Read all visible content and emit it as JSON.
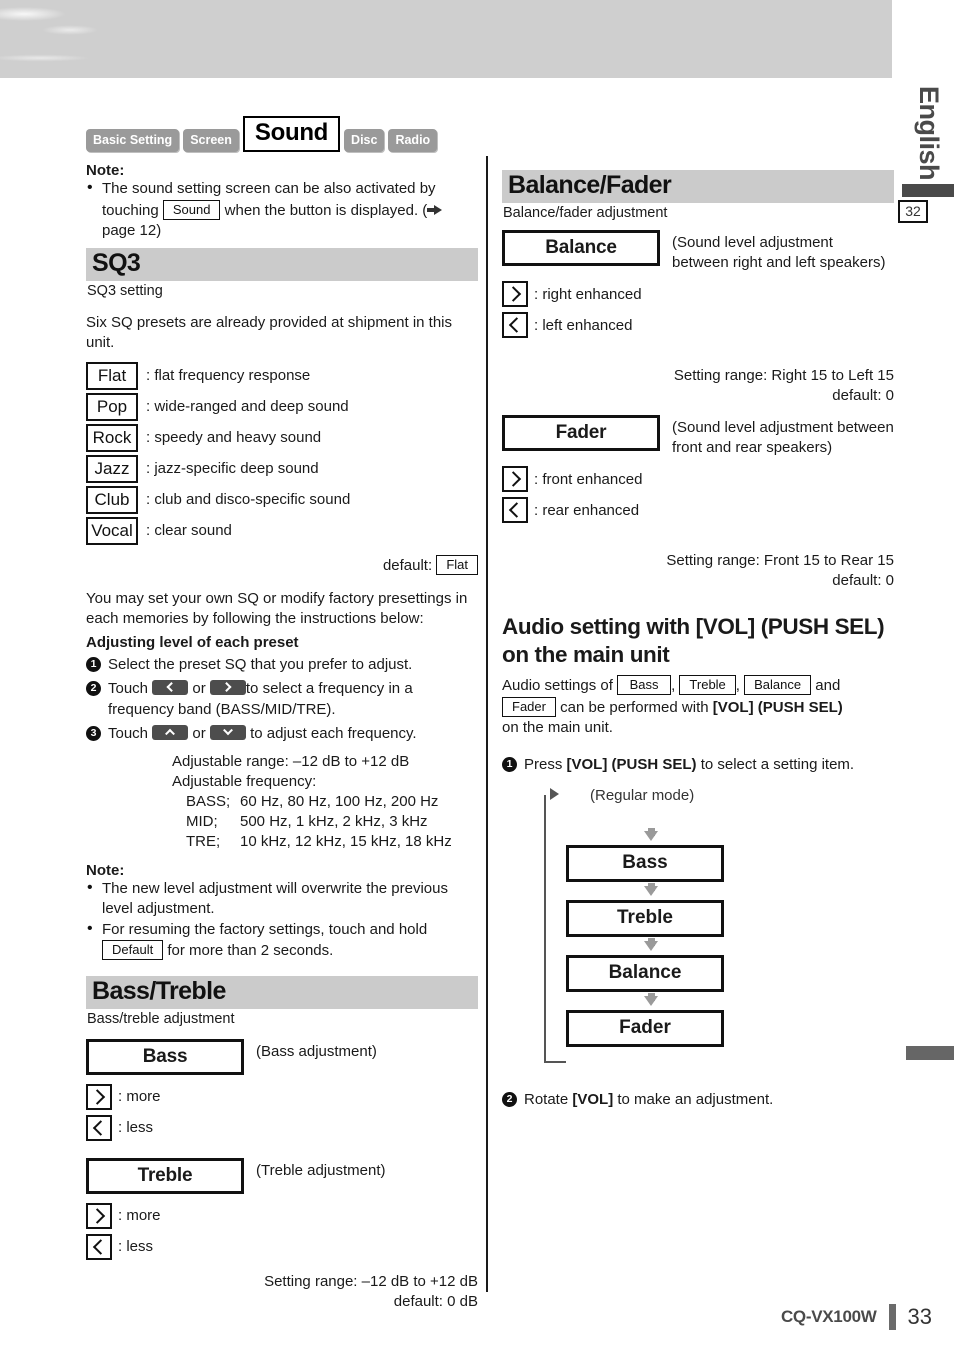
{
  "header": {
    "language_label": "English",
    "edge_page_marker": "32",
    "tabs": [
      {
        "label": "Basic Setting",
        "active": false
      },
      {
        "label": "Screen",
        "active": false
      },
      {
        "label": "Sound",
        "active": true
      },
      {
        "label": "Disc",
        "active": false
      },
      {
        "label": "Radio",
        "active": false
      }
    ]
  },
  "left": {
    "note_top": {
      "title": "Note:",
      "item_part1": "The sound setting screen can be also activated by touching",
      "inline_button": "Sound",
      "item_part2": "when the button is displayed. (",
      "item_part3": "page 12)"
    },
    "sq3": {
      "heading": "SQ3",
      "caption": "SQ3 setting",
      "intro": "Six SQ presets are already provided at shipment in this unit.",
      "presets": [
        {
          "name": "Flat",
          "desc": ": flat frequency response"
        },
        {
          "name": "Pop",
          "desc": ": wide-ranged and deep sound"
        },
        {
          "name": "Rock",
          "desc": ": speedy and heavy sound"
        },
        {
          "name": "Jazz",
          "desc": ": jazz-specific deep sound"
        },
        {
          "name": "Club",
          "desc": ": club and disco-specific sound"
        },
        {
          "name": "Vocal",
          "desc": ": clear sound"
        }
      ],
      "default_label": "default:",
      "default_value": "Flat",
      "body": "You may set your own SQ or modify factory presettings in each memories by following the instructions below:",
      "adjust_title": "Adjusting level of each preset",
      "step1_num": "1",
      "step1_text": "Select the preset SQ that you prefer to adjust.",
      "step2_num": "2",
      "step2_a": "Touch",
      "step2_b": "or",
      "step2_c": "to select a frequency in a frequency band (BASS/MID/TRE).",
      "step3_num": "3",
      "step3_a": "Touch",
      "step3_b": "or",
      "step3_c": "to adjust each frequency.",
      "spec_range": "Adjustable range: –12 dB to +12 dB",
      "spec_freq_title": "Adjustable frequency:",
      "spec_rows": [
        {
          "band": "BASS;",
          "values": "60 Hz, 80 Hz, 100 Hz, 200 Hz"
        },
        {
          "band": "MID;",
          "values": "500 Hz, 1 kHz, 2 kHz, 3 kHz"
        },
        {
          "band": "TRE;",
          "values": "10 kHz, 12 kHz, 15 kHz, 18 kHz"
        }
      ]
    },
    "note_bottom": {
      "title": "Note:",
      "item1": "The new level adjustment will overwrite the previous level adjustment.",
      "item2_a": "For resuming the factory settings, touch and hold",
      "item2_button": "Default",
      "item2_b": "for more than 2 seconds."
    },
    "bass_treble": {
      "heading": "Bass/Treble",
      "caption": "Bass/treble adjustment",
      "bass_button": "Bass",
      "bass_note": "(Bass adjustment)",
      "bass_more": ": more",
      "bass_less": ": less",
      "treble_button": "Treble",
      "treble_note": "(Treble adjustment)",
      "treble_more": ": more",
      "treble_less": ": less",
      "range_line1": "Setting range: –12 dB to +12 dB",
      "range_line2": "default: 0 dB"
    }
  },
  "right": {
    "balance_fader": {
      "heading": "Balance/Fader",
      "caption": "Balance/fader adjustment",
      "balance_button": "Balance",
      "balance_note_line1": "(Sound level adjustment",
      "balance_note_line2": "between right and left speakers)",
      "balance_right": ": right enhanced",
      "balance_left": ": left enhanced",
      "balance_range_line1": "Setting range: Right 15 to Left 15",
      "balance_range_line2": "default: 0",
      "fader_button": "Fader",
      "fader_note_line1": "(Sound level adjustment between",
      "fader_note_line2": "front and rear speakers)",
      "fader_front": ": front enhanced",
      "fader_rear": ": rear enhanced",
      "fader_range_line1": "Setting range: Front 15 to Rear 15",
      "fader_range_line2": "default: 0"
    },
    "vol_section": {
      "heading": "Audio setting with [VOL] (PUSH SEL) on the main unit",
      "intro_a": "Audio settings of",
      "btn_bass": "Bass",
      "sep1": ",",
      "btn_treble": "Treble",
      "sep2": ",",
      "btn_balance": "Balance",
      "intro_b": "and",
      "btn_fader": "Fader",
      "intro_c": "can be performed with",
      "intro_bold": "[VOL] (PUSH SEL)",
      "intro_d": "on the main unit.",
      "step1_num": "1",
      "step1_a": "Press",
      "step1_bold": "[VOL] (PUSH SEL)",
      "step1_b": "to select a setting item.",
      "flow_regular_mode": "(Regular mode)",
      "flow_items": [
        "Bass",
        "Treble",
        "Balance",
        "Fader"
      ],
      "step2_num": "2",
      "step2_a": "Rotate",
      "step2_bold": "[VOL]",
      "step2_b": "to make an adjustment."
    }
  },
  "footer": {
    "model": "CQ-VX100W",
    "page_number": "33"
  }
}
